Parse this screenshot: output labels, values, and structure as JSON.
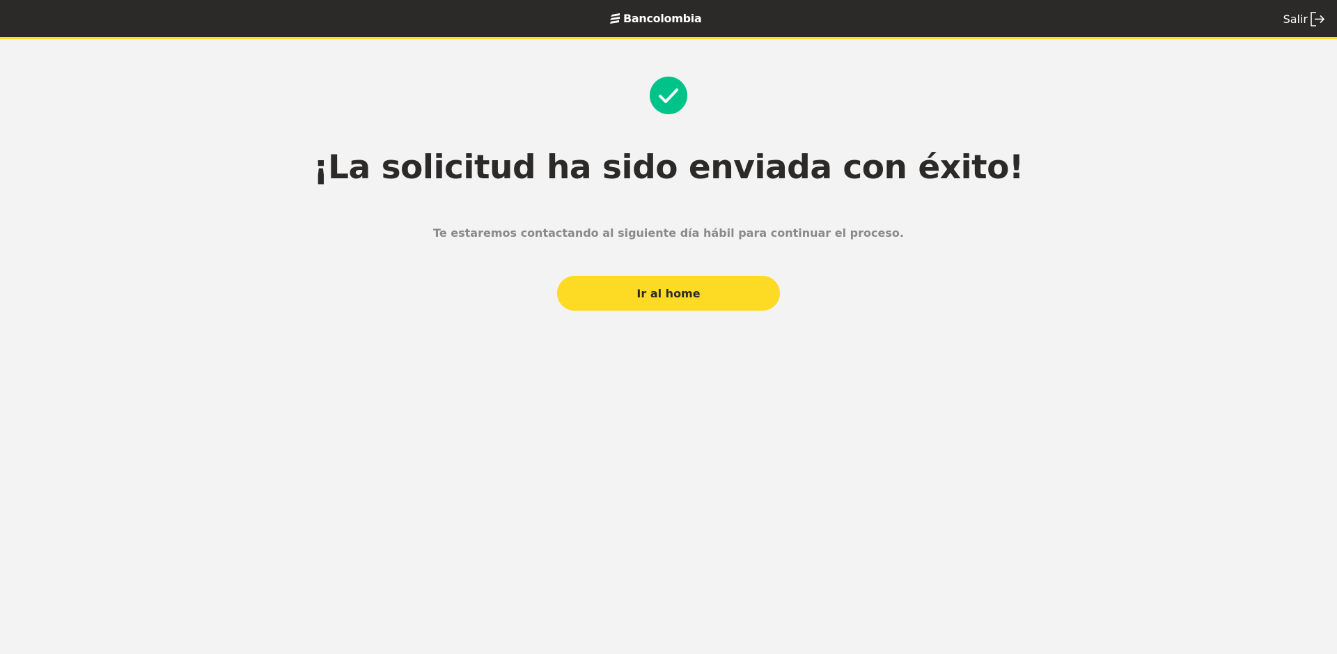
{
  "header": {
    "brand_name": "Bancolombia",
    "logo_icon": "bancolombia-logo-icon",
    "exit_label": "Salir",
    "exit_icon": "exit-icon",
    "background_color": "#2c2a29",
    "accent_color": "#fdda24"
  },
  "main": {
    "status_icon": "check-circle-icon",
    "status_color": "#00c389",
    "title": "¡La solicitud ha sido enviada con éxito!",
    "message": "Te estaremos contactando al siguiente día hábil para continuar el proceso.",
    "home_button_label": "Ir al home",
    "button_color": "#fdda24"
  }
}
